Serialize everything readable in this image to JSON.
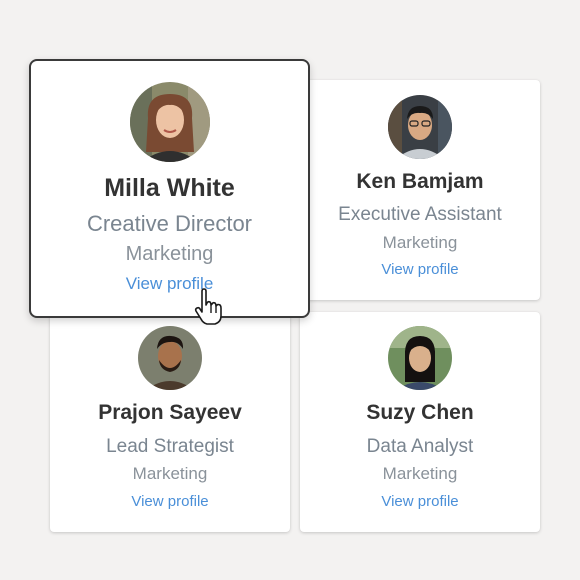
{
  "cards": [
    {
      "name": "Milla White",
      "role": "Creative Director",
      "department": "Marketing",
      "link": "View profile"
    },
    {
      "name": "Ken Bamjam",
      "role": "Executive Assistant",
      "department": "Marketing",
      "link": "View profile"
    },
    {
      "name": "Prajon Sayeev",
      "role": "Lead Strategist",
      "department": "Marketing",
      "link": "View profile"
    },
    {
      "name": "Suzy Chen",
      "role": "Data Analyst",
      "department": "Marketing",
      "link": "View profile"
    }
  ],
  "colors": {
    "name": "#333333",
    "role": "#7a8590",
    "link": "#4a8fd8",
    "background": "#f3f2f1"
  },
  "icons": {
    "cursor": "hand-pointer-icon"
  }
}
